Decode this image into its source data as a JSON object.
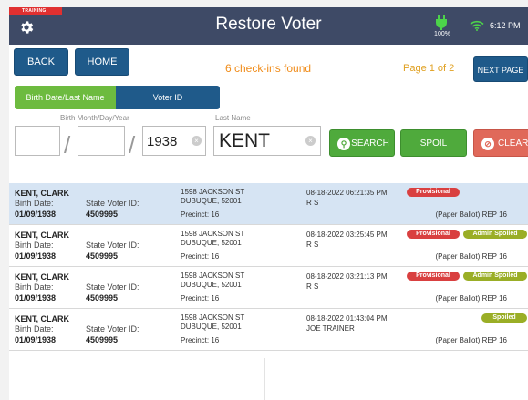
{
  "header": {
    "training_label": "TRAINING",
    "title": "Restore Voter",
    "battery_pct": "100%",
    "time": "6:12 PM"
  },
  "nav": {
    "back_label": "BACK",
    "home_label": "HOME",
    "next_label": "NEXT PAGE",
    "checkins_found": "6 check-ins found",
    "page_indicator": "Page 1 of 2"
  },
  "search_mode": {
    "option_birth": "Birth Date/Last Name",
    "option_voter": "Voter ID",
    "selected": "Birth Date/Last Name"
  },
  "search_form": {
    "birth_label": "Birth Month/Day/Year",
    "month_value": "",
    "day_value": "",
    "year_value": "1938",
    "lastname_label": "Last Name",
    "lastname_value": "KENT",
    "search_label": "SEARCH",
    "spoil_label": "SPOIL",
    "clear_label": "CLEAR"
  },
  "labels": {
    "birth_date": "Birth Date:",
    "state_voter_id": "State Voter ID:",
    "precinct_prefix": "Precinct:"
  },
  "results": [
    {
      "name": "KENT, CLARK",
      "birth_date": "01/09/1938",
      "voter_id": "4509995",
      "address1": "1598 JACKSON ST",
      "address2": "DUBUQUE, 52001",
      "precinct": "Precinct: 16",
      "timestamp": "08-18-2022 06:21:35 PM",
      "user": "R S",
      "ballot": "(Paper Ballot) REP 16",
      "badge1": "Provisional",
      "badge2": ""
    },
    {
      "name": "KENT, CLARK",
      "birth_date": "01/09/1938",
      "voter_id": "4509995",
      "address1": "1598 JACKSON ST",
      "address2": "DUBUQUE, 52001",
      "precinct": "Precinct: 16",
      "timestamp": "08-18-2022 03:25:45 PM",
      "user": "R S",
      "ballot": "(Paper Ballot) REP 16",
      "badge1": "Provisional",
      "badge2": "Admin Spoiled"
    },
    {
      "name": "KENT, CLARK",
      "birth_date": "01/09/1938",
      "voter_id": "4509995",
      "address1": "1598 JACKSON ST",
      "address2": "DUBUQUE, 52001",
      "precinct": "Precinct: 16",
      "timestamp": "08-18-2022 03:21:13 PM",
      "user": "R S",
      "ballot": "(Paper Ballot) REP 16",
      "badge1": "Provisional",
      "badge2": "Admin Spoiled"
    },
    {
      "name": "KENT, CLARK",
      "birth_date": "01/09/1938",
      "voter_id": "4509995",
      "address1": "1598 JACKSON ST",
      "address2": "DUBUQUE, 52001",
      "precinct": "Precinct: 16",
      "timestamp": "08-18-2022 01:43:04 PM",
      "user": "JOE TRAINER",
      "ballot": "(Paper Ballot) REP 16",
      "badge1": "",
      "badge2": "Spoiled"
    }
  ],
  "colors": {
    "header_bg": "#3e4a66",
    "primary_blue": "#1f5a8a",
    "accent_green": "#4faa3c",
    "clear_red": "#e0695a",
    "provisional_red": "#d94040",
    "spoiled_olive": "#9aae26",
    "found_orange": "#f08c1a"
  }
}
